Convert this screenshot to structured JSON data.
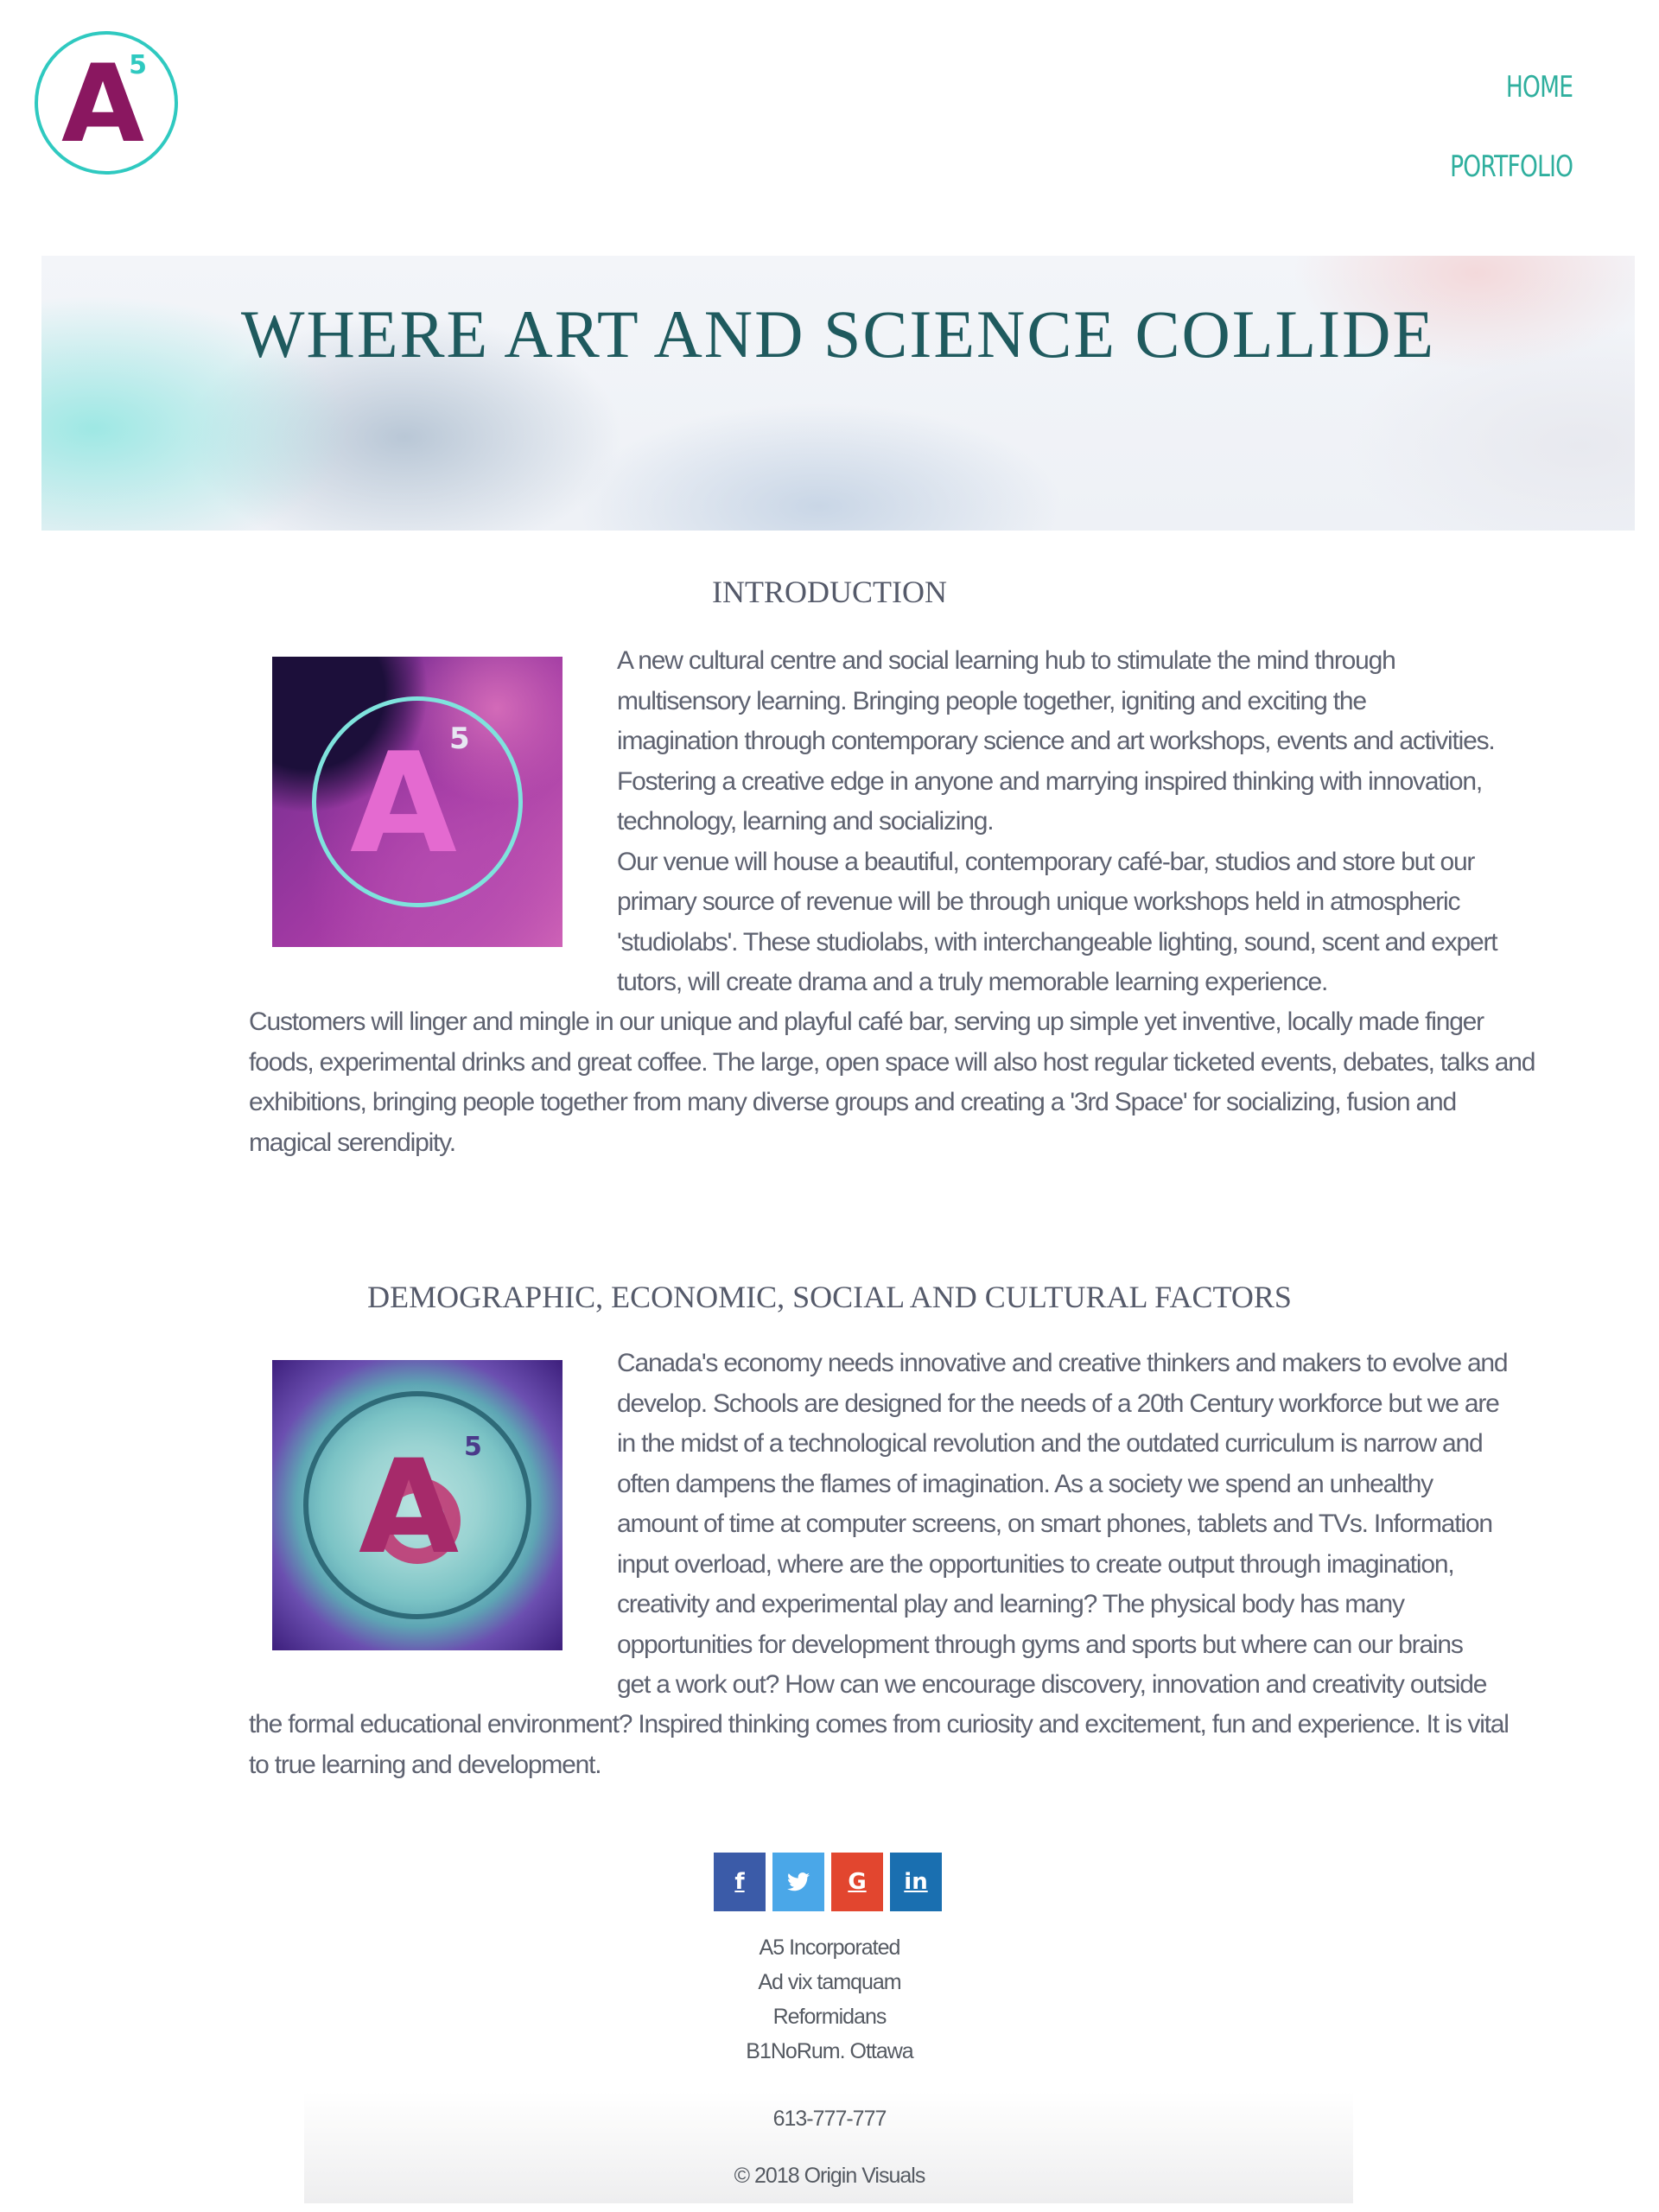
{
  "header": {
    "logo": {
      "letter": "A",
      "superscript": "5",
      "colors": {
        "ring": "#2fc9c0",
        "letter": "#8a1760"
      }
    },
    "nav": [
      {
        "label": "HOME"
      },
      {
        "label": "PORTFOLIO"
      }
    ]
  },
  "hero": {
    "title": "WHERE ART AND SCIENCE COLLIDE"
  },
  "introduction": {
    "heading": "INTRODUCTION",
    "image": {
      "letter": "A",
      "superscript": "5"
    },
    "lines": [
      "A new cultural centre and social learning hub to stimulate the mind through",
      "multisensory learning. Bringing people together, igniting and exciting the",
      "imagination through contemporary science and art workshops, events and activities.",
      "Fostering a creative edge in anyone and marrying inspired thinking with innovation,",
      "technology, learning and socializing.",
      "Our venue will house a beautiful, contemporary café-bar, studios and store but our",
      "primary source of revenue will be through unique workshops held in atmospheric",
      "'studiolabs'. These studiolabs, with interchangeable lighting, sound, scent and expert",
      "tutors, will create drama and a truly memorable learning experience."
    ],
    "wide_lines": [
      "Customers will linger and mingle in our unique and playful café bar, serving up simple yet inventive, locally made finger",
      "foods, experimental drinks and great coffee. The large, open space will also host regular ticketed events, debates, talks and",
      "exhibitions, bringing people together from many diverse groups and creating a '3rd Space' for socializing, fusion and",
      "magical serendipity."
    ]
  },
  "factors": {
    "heading": "DEMOGRAPHIC, ECONOMIC, SOCIAL AND CULTURAL FACTORS",
    "image": {
      "letter": "A",
      "superscript": "5"
    },
    "lines": [
      "Canada's economy needs innovative and creative thinkers and makers to evolve and",
      "develop. Schools are designed for the needs of a 20th Century workforce but we are",
      "in the midst of a technological revolution and the outdated curriculum is narrow and",
      "often dampens the flames of imagination. As a society we spend an unhealthy",
      "amount of time at computer screens, on smart phones, tablets and TVs. Information",
      "input overload, where are the opportunities to create output through imagination,",
      "creativity and experimental play and learning? The physical body has many",
      "opportunities for development through gyms and sports but where can our brains",
      "get a work out? How can we encourage discovery, innovation and creativity outside"
    ],
    "wide_lines": [
      "the formal educational environment? Inspired thinking comes from curiosity and excitement, fun and experience. It is vital",
      "to true learning and development."
    ]
  },
  "social": [
    {
      "glyph": "f",
      "icon": "facebook-icon",
      "color": "#3b5ba8"
    },
    {
      "glyph": "t",
      "icon": "twitter-icon",
      "color": "#4aa7e8"
    },
    {
      "glyph": "G",
      "icon": "google-icon",
      "color": "#e2462f"
    },
    {
      "glyph": "in",
      "icon": "linkedin-icon",
      "color": "#1a6fb0"
    }
  ],
  "footer": {
    "address": [
      "A5 Incorporated",
      "Ad vix tamquam",
      "Reformidans",
      "B1NoRum. Ottawa"
    ],
    "phone": "613-777-777",
    "copyright": "© 2018 Origin Visuals"
  }
}
